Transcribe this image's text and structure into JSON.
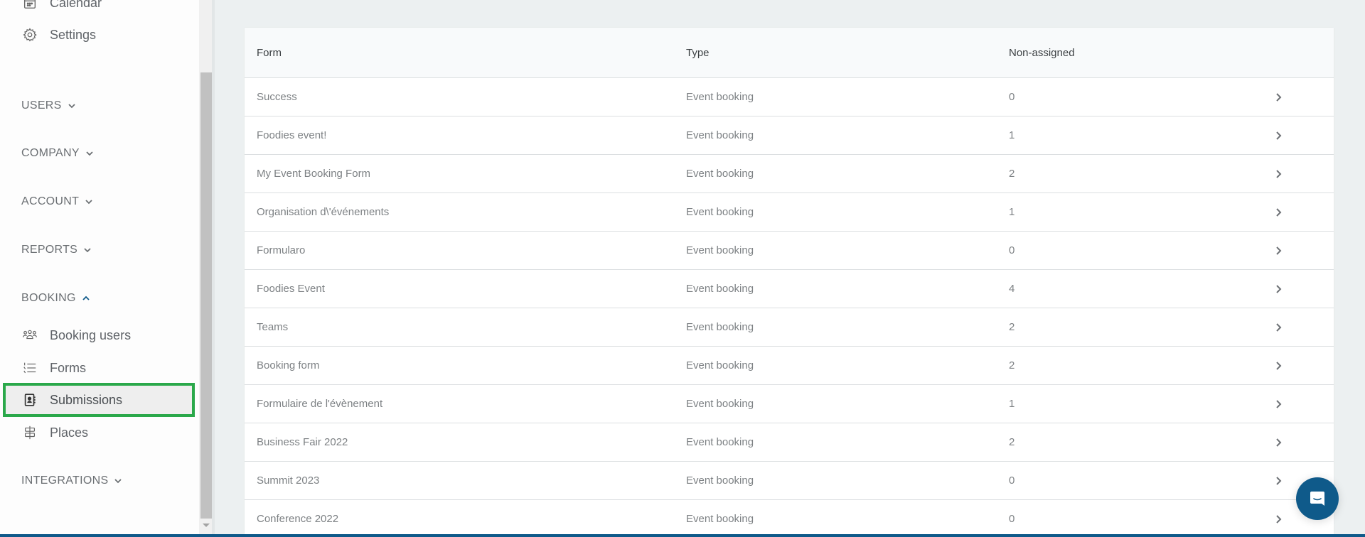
{
  "sidebar": {
    "top_items": [
      {
        "label": "Calendar",
        "icon": "calendar-icon"
      },
      {
        "label": "Settings",
        "icon": "gear-icon"
      }
    ],
    "sections": [
      {
        "label": "USERS",
        "expanded": false
      },
      {
        "label": "COMPANY",
        "expanded": false
      },
      {
        "label": "ACCOUNT",
        "expanded": false
      },
      {
        "label": "REPORTS",
        "expanded": false
      },
      {
        "label": "BOOKING",
        "expanded": true
      },
      {
        "label": "INTEGRATIONS",
        "expanded": false
      }
    ],
    "booking_items": [
      {
        "label": "Booking users",
        "icon": "users-icon"
      },
      {
        "label": "Forms",
        "icon": "numbered-list-icon"
      },
      {
        "label": "Submissions",
        "icon": "contact-book-icon",
        "active": true
      },
      {
        "label": "Places",
        "icon": "signpost-icon"
      }
    ],
    "highlight_color": "#2aa84a",
    "accent_color": "#0f5a8a"
  },
  "table": {
    "headers": {
      "form": "Form",
      "type": "Type",
      "non_assigned": "Non-assigned"
    },
    "rows": [
      {
        "form": "Success",
        "type": "Event booking",
        "non_assigned": "0"
      },
      {
        "form": "Foodies event!",
        "type": "Event booking",
        "non_assigned": "1"
      },
      {
        "form": "My Event Booking Form",
        "type": "Event booking",
        "non_assigned": "2"
      },
      {
        "form": "Organisation d\\'événements",
        "type": "Event booking",
        "non_assigned": "1"
      },
      {
        "form": "Formularo",
        "type": "Event booking",
        "non_assigned": "0"
      },
      {
        "form": "Foodies Event",
        "type": "Event booking",
        "non_assigned": "4"
      },
      {
        "form": "Teams",
        "type": "Event booking",
        "non_assigned": "2"
      },
      {
        "form": "Booking form",
        "type": "Event booking",
        "non_assigned": "2"
      },
      {
        "form": "Formulaire de l'évènement",
        "type": "Event booking",
        "non_assigned": "1"
      },
      {
        "form": "Business Fair 2022",
        "type": "Event booking",
        "non_assigned": "2"
      },
      {
        "form": "Summit 2023",
        "type": "Event booking",
        "non_assigned": "0"
      },
      {
        "form": "Conference 2022",
        "type": "Event booking",
        "non_assigned": "0"
      }
    ]
  },
  "chat": {
    "icon": "chat-icon"
  }
}
